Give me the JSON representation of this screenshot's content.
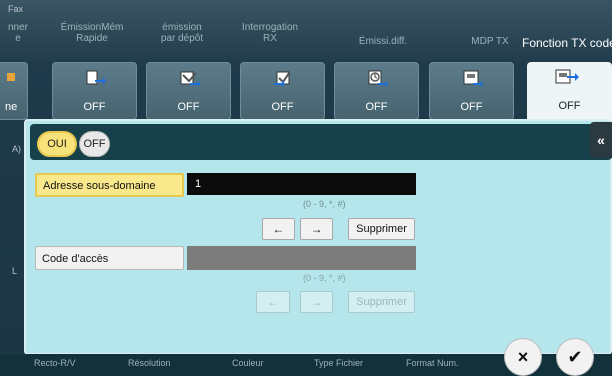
{
  "header": {
    "fax_label": "Fax",
    "tabs": [
      {
        "label": "nner\ne"
      },
      {
        "label": "ÉmissionMém\nRapide"
      },
      {
        "label": "émission\npar dépôt"
      },
      {
        "label": "Interrogation\nRX"
      },
      {
        "label": "Émissi.diff."
      },
      {
        "label": "MDP TX"
      }
    ],
    "active_tab": {
      "label": "Fonction TX code F"
    }
  },
  "function_buttons": [
    {
      "name": "partial-left",
      "state": "ne",
      "icon": "partial-icon"
    },
    {
      "name": "emission-mem-rapide",
      "state": "OFF",
      "icon": "quick-memory-tx-icon"
    },
    {
      "name": "emission-par-depot",
      "state": "OFF",
      "icon": "polling-tx-icon"
    },
    {
      "name": "interrogation-rx",
      "state": "OFF",
      "icon": "polling-rx-icon"
    },
    {
      "name": "emission-differee",
      "state": "OFF",
      "icon": "timer-tx-icon"
    },
    {
      "name": "mdp-tx",
      "state": "OFF",
      "icon": "password-tx-icon"
    },
    {
      "name": "fonction-tx-code-f",
      "state": "OFF",
      "icon": "f-code-tx-icon"
    }
  ],
  "left_side": {
    "label_a": "A)",
    "label_l": "L"
  },
  "panel": {
    "toggle": {
      "on_label": "OUI",
      "off_label": "OFF",
      "selected": "OUI"
    },
    "collapse_icon": "collapse-left-icon",
    "subaddress": {
      "button_label": "Adresse sous-domaine",
      "value": "1",
      "hint": "(0 - 9, *, #)",
      "left_arrow": "←",
      "right_arrow": "→",
      "delete_label": "Supprimer"
    },
    "access_code": {
      "button_label": "Code d'accès",
      "value": "",
      "hint": "(0 - 9, *, #)",
      "left_arrow": "←",
      "right_arrow": "→",
      "delete_label": "Supprimer"
    }
  },
  "bottom_bar": {
    "items": [
      "Recto-R/V",
      "Résolution",
      "Couleur",
      "Type Fichier",
      "Format Num."
    ],
    "cancel_icon": "×",
    "ok_icon": "✔"
  },
  "colors": {
    "accent_yellow": "#f9e98c",
    "panel_bg": "#b4e6ec",
    "dark_bar": "#17404a"
  }
}
